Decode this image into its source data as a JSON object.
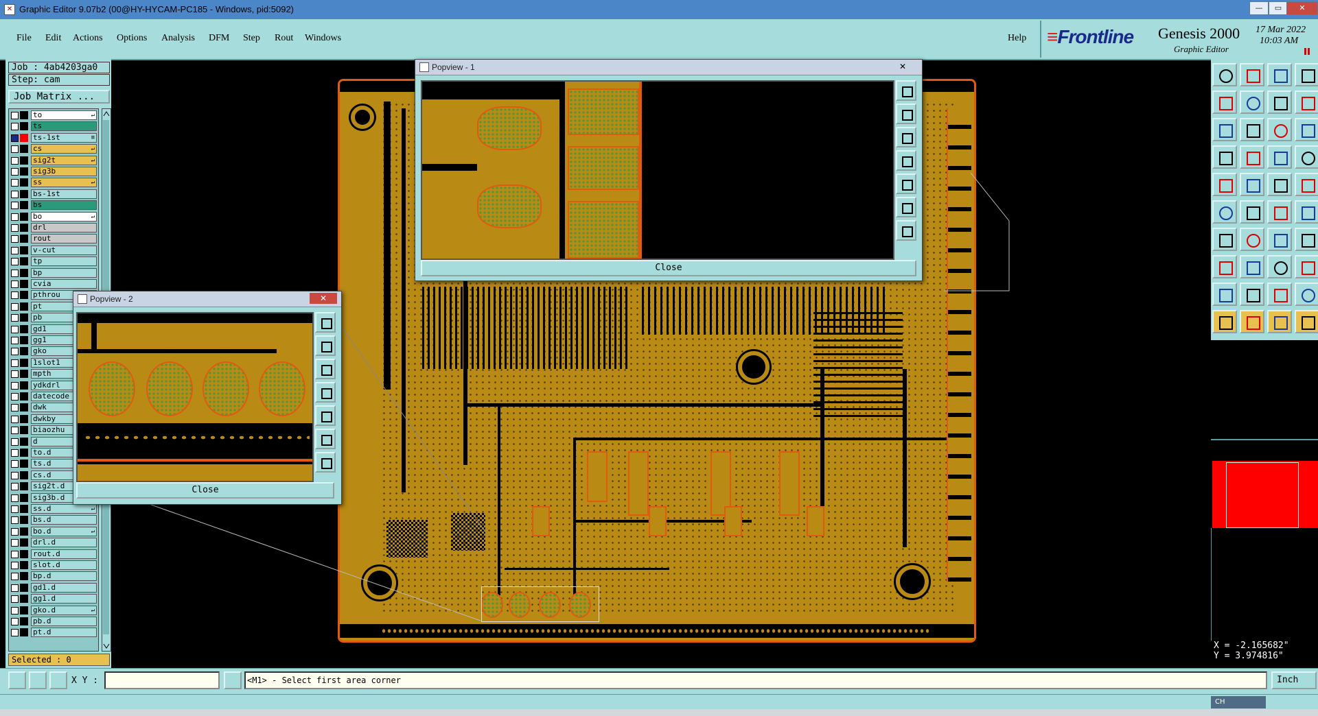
{
  "window": {
    "title": "Graphic Editor 9.07b2 (00@HY-HYCAM-PC185 - Windows, pid:5092)",
    "minimize": "—",
    "maximize": "▭",
    "close": "✕"
  },
  "menu": {
    "file": "File",
    "edit": "Edit",
    "actions": "Actions",
    "options": "Options",
    "analysis": "Analysis",
    "dfm": "DFM",
    "step": "Step",
    "rout": "Rout",
    "windows": "Windows",
    "help": "Help"
  },
  "branding": {
    "frontline": "Frontline",
    "product": "Genesis 2000",
    "subtitle": "Graphic Editor",
    "date_line1": "17 Mar 2022",
    "date_line2": "10:03 AM"
  },
  "left_panel": {
    "job": "Job : 4ab4203ga0",
    "step": "Step: cam",
    "job_matrix": "Job Matrix ...",
    "selected": "Selected : 0"
  },
  "layers": [
    {
      "name": "to",
      "color": "#000000",
      "bg": "#ffffff",
      "mark": "↵",
      "checked": false
    },
    {
      "name": "ts",
      "color": "#000000",
      "bg": "#2a9a7a",
      "mark": "",
      "checked": false
    },
    {
      "name": "ts-1st",
      "color": "#ff0000",
      "bg": "#a7dcdc",
      "mark": "≡",
      "checked": true
    },
    {
      "name": "cs",
      "color": "#000000",
      "bg": "#e8c050",
      "mark": "↵",
      "checked": false
    },
    {
      "name": "sig2t",
      "color": "#000000",
      "bg": "#e8c050",
      "mark": "↵",
      "checked": false
    },
    {
      "name": "sig3b",
      "color": "#000000",
      "bg": "#e8c050",
      "mark": "",
      "checked": false
    },
    {
      "name": "ss",
      "color": "#000000",
      "bg": "#e8c050",
      "mark": "↵",
      "checked": false
    },
    {
      "name": "bs-1st",
      "color": "#000000",
      "bg": "#a7dcdc",
      "mark": "",
      "checked": false
    },
    {
      "name": "bs",
      "color": "#000000",
      "bg": "#2a9a7a",
      "mark": "",
      "checked": false
    },
    {
      "name": "bo",
      "color": "#000000",
      "bg": "#ffffff",
      "mark": "↵",
      "checked": false
    },
    {
      "name": "drl",
      "color": "#000000",
      "bg": "#c8c8c8",
      "mark": "",
      "checked": false
    },
    {
      "name": "rout",
      "color": "#000000",
      "bg": "#c8c8c8",
      "mark": "",
      "checked": false
    },
    {
      "name": "v-cut",
      "color": "#000000",
      "bg": "#a7dcdc",
      "mark": "",
      "checked": false
    },
    {
      "name": "tp",
      "color": "#000000",
      "bg": "#a7dcdc",
      "mark": "",
      "checked": false
    },
    {
      "name": "bp",
      "color": "#000000",
      "bg": "#a7dcdc",
      "mark": "",
      "checked": false
    },
    {
      "name": "cvia",
      "color": "#000000",
      "bg": "#a7dcdc",
      "mark": "",
      "checked": false
    },
    {
      "name": "pthrou",
      "color": "#000000",
      "bg": "#a7dcdc",
      "mark": "",
      "checked": false
    },
    {
      "name": "pt",
      "color": "#000000",
      "bg": "#a7dcdc",
      "mark": "",
      "checked": false
    },
    {
      "name": "pb",
      "color": "#000000",
      "bg": "#a7dcdc",
      "mark": "",
      "checked": false
    },
    {
      "name": "gd1",
      "color": "#000000",
      "bg": "#a7dcdc",
      "mark": "",
      "checked": false
    },
    {
      "name": "gg1",
      "color": "#000000",
      "bg": "#a7dcdc",
      "mark": "",
      "checked": false
    },
    {
      "name": "gko",
      "color": "#000000",
      "bg": "#a7dcdc",
      "mark": "",
      "checked": false
    },
    {
      "name": "1slot1",
      "color": "#000000",
      "bg": "#a7dcdc",
      "mark": "",
      "checked": false
    },
    {
      "name": "mpth",
      "color": "#000000",
      "bg": "#a7dcdc",
      "mark": "",
      "checked": false
    },
    {
      "name": "ydkdrl",
      "color": "#000000",
      "bg": "#a7dcdc",
      "mark": "",
      "checked": false
    },
    {
      "name": "datecode",
      "color": "#000000",
      "bg": "#a7dcdc",
      "mark": "",
      "checked": false
    },
    {
      "name": "dwk",
      "color": "#000000",
      "bg": "#a7dcdc",
      "mark": "",
      "checked": false
    },
    {
      "name": "dwkby",
      "color": "#000000",
      "bg": "#a7dcdc",
      "mark": "",
      "checked": false
    },
    {
      "name": "biaozhu",
      "color": "#000000",
      "bg": "#a7dcdc",
      "mark": "",
      "checked": false
    },
    {
      "name": "d",
      "color": "#000000",
      "bg": "#a7dcdc",
      "mark": "",
      "checked": false
    },
    {
      "name": "to.d",
      "color": "#000000",
      "bg": "#a7dcdc",
      "mark": "",
      "checked": false
    },
    {
      "name": "ts.d",
      "color": "#000000",
      "bg": "#a7dcdc",
      "mark": "",
      "checked": false
    },
    {
      "name": "cs.d",
      "color": "#000000",
      "bg": "#a7dcdc",
      "mark": "",
      "checked": false
    },
    {
      "name": "sig2t.d",
      "color": "#000000",
      "bg": "#a7dcdc",
      "mark": "",
      "checked": false
    },
    {
      "name": "sig3b.d",
      "color": "#000000",
      "bg": "#a7dcdc",
      "mark": "",
      "checked": false
    },
    {
      "name": "ss.d",
      "color": "#000000",
      "bg": "#a7dcdc",
      "mark": "↵",
      "checked": false
    },
    {
      "name": "bs.d",
      "color": "#000000",
      "bg": "#a7dcdc",
      "mark": "",
      "checked": false
    },
    {
      "name": "bo.d",
      "color": "#000000",
      "bg": "#a7dcdc",
      "mark": "↵",
      "checked": false
    },
    {
      "name": "drl.d",
      "color": "#000000",
      "bg": "#a7dcdc",
      "mark": "",
      "checked": false
    },
    {
      "name": "rout.d",
      "color": "#000000",
      "bg": "#a7dcdc",
      "mark": "",
      "checked": false
    },
    {
      "name": "slot.d",
      "color": "#000000",
      "bg": "#a7dcdc",
      "mark": "",
      "checked": false
    },
    {
      "name": "bp.d",
      "color": "#000000",
      "bg": "#a7dcdc",
      "mark": "",
      "checked": false
    },
    {
      "name": "gd1.d",
      "color": "#000000",
      "bg": "#a7dcdc",
      "mark": "",
      "checked": false
    },
    {
      "name": "gg1.d",
      "color": "#000000",
      "bg": "#a7dcdc",
      "mark": "",
      "checked": false
    },
    {
      "name": "gko.d",
      "color": "#000000",
      "bg": "#a7dcdc",
      "mark": "↵",
      "checked": false
    },
    {
      "name": "pb.d",
      "color": "#000000",
      "bg": "#a7dcdc",
      "mark": "",
      "checked": false
    },
    {
      "name": "pt.d",
      "color": "#000000",
      "bg": "#a7dcdc",
      "mark": "",
      "checked": false
    }
  ],
  "popview1": {
    "title": "Popview - 1",
    "close_label": "Close",
    "close_x": "✕"
  },
  "popview2": {
    "title": "Popview - 2",
    "close_label": "Close",
    "close_x": "✕"
  },
  "coords": {
    "x": "X = -2.165682\"",
    "y": "Y = 3.974816\""
  },
  "bottom": {
    "xy_label": "X Y :",
    "xy_value": "",
    "prompt": "<M1> - Select first area corner",
    "units": "Inch"
  },
  "tray": {
    "lang": "CH"
  },
  "colors": {
    "panel": "#a7dcdc",
    "board": "#b98a14",
    "outline": "#e05a10",
    "selection_red": "#ff0000"
  }
}
